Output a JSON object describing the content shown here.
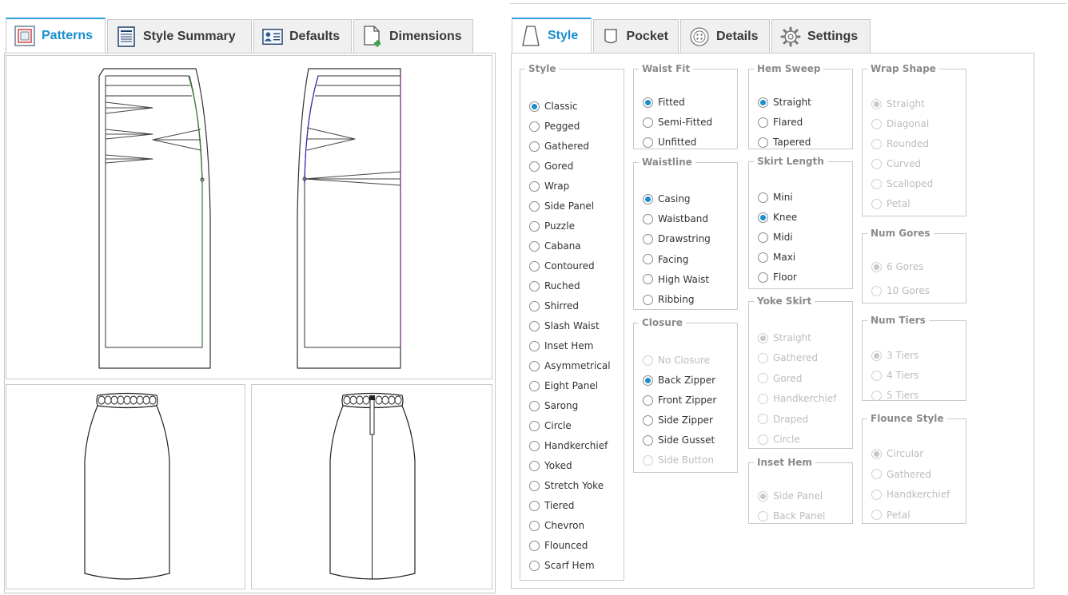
{
  "left_tabs": [
    {
      "label": "Patterns",
      "icon": "patterns-icon",
      "active": true
    },
    {
      "label": "Style Summary",
      "icon": "document-icon",
      "active": false
    },
    {
      "label": "Defaults",
      "icon": "profile-card-icon",
      "active": false
    },
    {
      "label": "Dimensions",
      "icon": "new-document-icon",
      "active": false
    }
  ],
  "right_tabs": [
    {
      "label": "Style",
      "icon": "skirt-icon",
      "active": true
    },
    {
      "label": "Pocket",
      "icon": "pocket-icon",
      "active": false
    },
    {
      "label": "Details",
      "icon": "button-icon",
      "active": false
    },
    {
      "label": "Settings",
      "icon": "gear-icon",
      "active": false
    }
  ],
  "groups": {
    "style": {
      "title": "Style",
      "options": [
        {
          "label": "Classic",
          "checked": true
        },
        {
          "label": "Pegged"
        },
        {
          "label": "Gathered"
        },
        {
          "label": "Gored"
        },
        {
          "label": "Wrap"
        },
        {
          "label": "Side Panel"
        },
        {
          "label": "Puzzle"
        },
        {
          "label": "Cabana"
        },
        {
          "label": "Contoured"
        },
        {
          "label": "Ruched"
        },
        {
          "label": "Shirred"
        },
        {
          "label": "Slash Waist"
        },
        {
          "label": "Inset Hem"
        },
        {
          "label": "Asymmetrical"
        },
        {
          "label": "Eight Panel"
        },
        {
          "label": "Sarong"
        },
        {
          "label": "Circle"
        },
        {
          "label": "Handkerchief"
        },
        {
          "label": "Yoked"
        },
        {
          "label": "Stretch Yoke"
        },
        {
          "label": "Tiered"
        },
        {
          "label": "Chevron"
        },
        {
          "label": "Flounced"
        },
        {
          "label": "Scarf Hem"
        }
      ]
    },
    "waist_fit": {
      "title": "Waist Fit",
      "options": [
        {
          "label": "Fitted",
          "checked": true
        },
        {
          "label": "Semi-Fitted"
        },
        {
          "label": "Unfitted"
        }
      ]
    },
    "waistline": {
      "title": "Waistline",
      "options": [
        {
          "label": "Casing",
          "checked": true
        },
        {
          "label": "Waistband"
        },
        {
          "label": "Drawstring"
        },
        {
          "label": "Facing"
        },
        {
          "label": "High Waist"
        },
        {
          "label": "Ribbing"
        }
      ]
    },
    "closure": {
      "title": "Closure",
      "options": [
        {
          "label": "No Closure",
          "disabled": true
        },
        {
          "label": "Back Zipper",
          "checked": true
        },
        {
          "label": "Front Zipper"
        },
        {
          "label": "Side Zipper"
        },
        {
          "label": "Side Gusset"
        },
        {
          "label": "Side Button",
          "disabled": true
        }
      ]
    },
    "hem_sweep": {
      "title": "Hem Sweep",
      "options": [
        {
          "label": "Straight",
          "checked": true
        },
        {
          "label": "Flared"
        },
        {
          "label": "Tapered"
        }
      ]
    },
    "skirt_length": {
      "title": "Skirt Length",
      "options": [
        {
          "label": "Mini"
        },
        {
          "label": "Knee",
          "checked": true
        },
        {
          "label": "Midi"
        },
        {
          "label": "Maxi"
        },
        {
          "label": "Floor"
        }
      ]
    },
    "yoke_skirt": {
      "title": "Yoke Skirt",
      "options": [
        {
          "label": "Straight",
          "checked": true,
          "disabled": true
        },
        {
          "label": "Gathered",
          "disabled": true
        },
        {
          "label": "Gored",
          "disabled": true
        },
        {
          "label": "Handkerchief",
          "disabled": true
        },
        {
          "label": "Draped",
          "disabled": true
        },
        {
          "label": "Circle",
          "disabled": true
        }
      ]
    },
    "inset_hem": {
      "title": "Inset Hem",
      "options": [
        {
          "label": "Side Panel",
          "checked": true,
          "disabled": true
        },
        {
          "label": "Back Panel",
          "disabled": true
        }
      ]
    },
    "wrap_shape": {
      "title": "Wrap Shape",
      "options": [
        {
          "label": "Straight",
          "checked": true,
          "disabled": true
        },
        {
          "label": "Diagonal",
          "disabled": true
        },
        {
          "label": "Rounded",
          "disabled": true
        },
        {
          "label": "Curved",
          "disabled": true
        },
        {
          "label": "Scalloped",
          "disabled": true
        },
        {
          "label": "Petal",
          "disabled": true
        }
      ]
    },
    "num_gores": {
      "title": "Num Gores",
      "options": [
        {
          "label": "6 Gores",
          "checked": true,
          "disabled": true
        },
        {
          "label": "10 Gores",
          "disabled": true
        }
      ]
    },
    "num_tiers": {
      "title": "Num Tiers",
      "options": [
        {
          "label": "3 Tiers",
          "checked": true,
          "disabled": true
        },
        {
          "label": "4 Tiers",
          "disabled": true
        },
        {
          "label": "5 Tiers",
          "disabled": true
        }
      ]
    },
    "flounce_style": {
      "title": "Flounce Style",
      "options": [
        {
          "label": "Circular",
          "checked": true,
          "disabled": true
        },
        {
          "label": "Gathered",
          "disabled": true
        },
        {
          "label": "Handkerchief",
          "disabled": true
        },
        {
          "label": "Petal",
          "disabled": true
        }
      ]
    }
  },
  "colors": {
    "accent": "#1a8fd0",
    "border": "#c8c8c8",
    "disabled_text": "#bcbcbc",
    "legend": "#8a8a8a"
  }
}
